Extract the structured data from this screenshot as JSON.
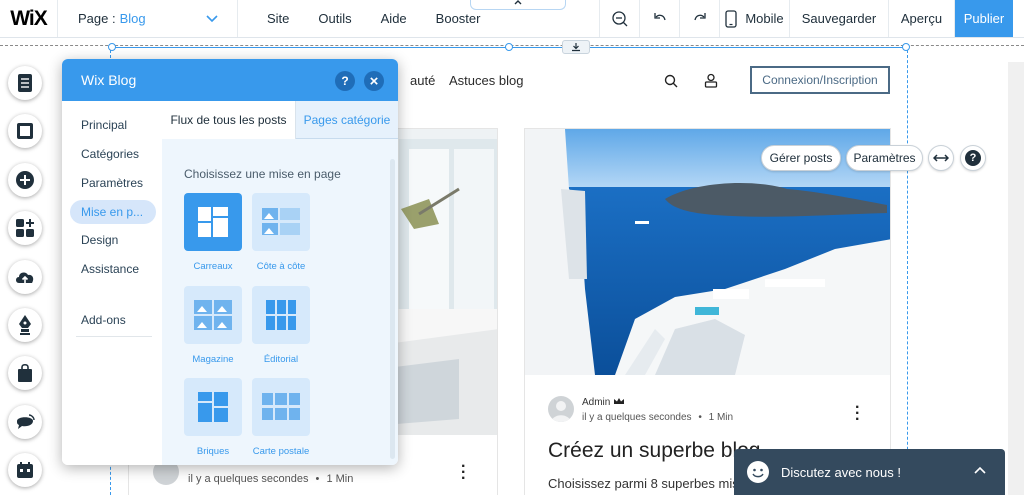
{
  "topbar": {
    "logo": "WiX",
    "page_label": "Page :",
    "page_value": "Blog",
    "menu": [
      "Site",
      "Outils",
      "Aide",
      "Booster"
    ],
    "mobile_label": "Mobile",
    "save_label": "Sauvegarder",
    "preview_label": "Aperçu",
    "publish_label": "Publier"
  },
  "site": {
    "nav_partial": "auté",
    "nav_tips": "Astuces blog",
    "login_label": "Connexion/Inscription"
  },
  "blog_toolbar": {
    "manage_posts": "Gérer posts",
    "settings": "Paramètres",
    "help": "?"
  },
  "post_right": {
    "author": "Admin",
    "time": "il y a quelques secondes",
    "separator": "•",
    "read_time": "1 Min",
    "title": "Créez un superbe blog",
    "excerpt": "Choisissez parmi 8 superbes mises e"
  },
  "post_left": {
    "time": "il y a quelques secondes",
    "separator": "•",
    "read_time": "1 Min"
  },
  "panel": {
    "title": "Wix Blog",
    "help": "?",
    "close": "×",
    "nav": [
      "Principal",
      "Catégories",
      "Paramètres",
      "Mise en p...",
      "Design",
      "Assistance"
    ],
    "addons": "Add-ons",
    "tabs": [
      "Flux de tous les posts",
      "Pages catégorie"
    ],
    "choose_label": "Choisissez une mise en page",
    "layouts": [
      "Carreaux",
      "Côte à côte",
      "Magazine",
      "Éditorial",
      "Briques",
      "Carte postale"
    ],
    "selected_layout": "Carreaux"
  },
  "chat": {
    "label": "Discutez avec nous !"
  },
  "colors": {
    "accent": "#3899ec",
    "chat_bg": "#344a5e",
    "sea": "#1b6fc4"
  }
}
